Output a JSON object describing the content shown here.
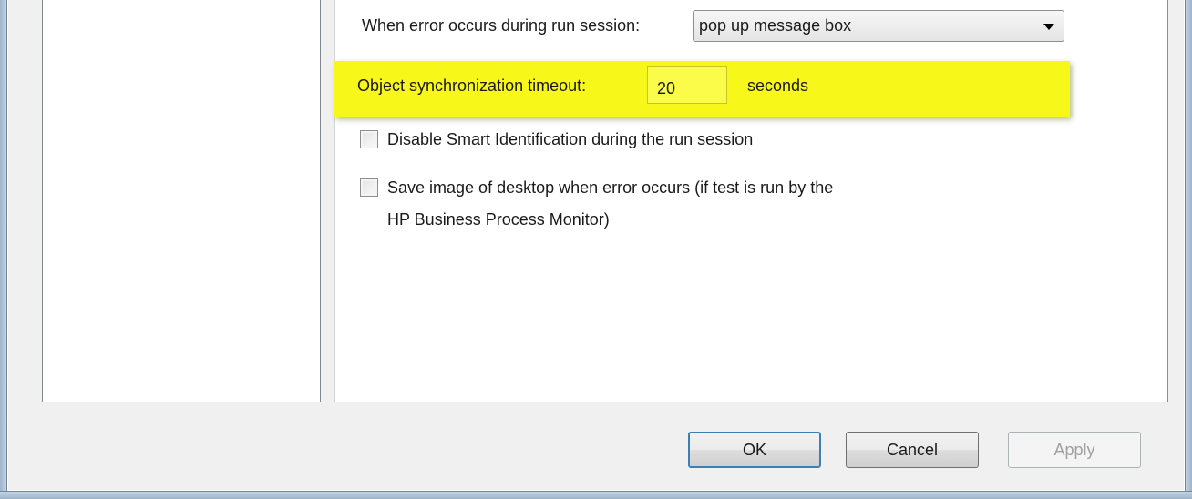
{
  "error_setting": {
    "label": "When error occurs during run session:",
    "value": "pop up message box"
  },
  "timeout": {
    "label": "Object synchronization timeout:",
    "value": "20",
    "unit": "seconds",
    "highlight_color": "#f7f71a"
  },
  "smart_id": {
    "label": "Disable Smart Identification during the run session",
    "checked": false
  },
  "save_image": {
    "label_line1": "Save image of desktop when error occurs (if test is run by the",
    "label_line2": "HP Business Process Monitor)",
    "checked": false
  },
  "buttons": {
    "ok": "OK",
    "cancel": "Cancel",
    "apply": "Apply"
  }
}
